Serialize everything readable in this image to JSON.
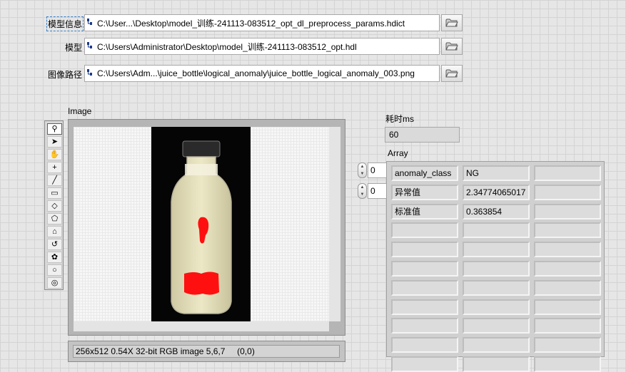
{
  "paths": [
    {
      "label": "模型信息",
      "value": "C:\\User...\\Desktop\\model_训练-241113-083512_opt_dl_preprocess_params.hdict"
    },
    {
      "label": "模型",
      "value": "C:\\Users\\Administrator\\Desktop\\model_训练-241113-083512_opt.hdl"
    },
    {
      "label": "图像路径",
      "value": "C:\\Users\\Adm...\\juice_bottle\\logical_anomaly\\juice_bottle_logical_anomaly_003.png"
    }
  ],
  "image_display": {
    "label": "Image",
    "status": "256x512 0.54X 32-bit RGB image 5,6,7     (0,0)",
    "tools": [
      "zoom-icon",
      "arrow-icon",
      "pan-icon",
      "crosshair-icon",
      "line-icon",
      "rectangle-icon",
      "rotated-rectangle-icon",
      "polygon-icon",
      "polyline-icon",
      "freehand-icon",
      "freehand-region-icon",
      "oval-icon",
      "annulus-icon"
    ]
  },
  "elapsed": {
    "label": "耗时ms",
    "value": "60"
  },
  "array": {
    "label": "Array",
    "index_row": "0",
    "index_col": "0",
    "rows": [
      [
        "anomaly_class",
        "NG",
        ""
      ],
      [
        "异常值",
        "2.34774065017",
        ""
      ],
      [
        "标准值",
        "0.363854",
        ""
      ],
      [
        "",
        "",
        ""
      ],
      [
        "",
        "",
        ""
      ],
      [
        "",
        "",
        ""
      ],
      [
        "",
        "",
        ""
      ],
      [
        "",
        "",
        ""
      ],
      [
        "",
        "",
        ""
      ],
      [
        "",
        "",
        ""
      ],
      [
        "",
        "",
        ""
      ]
    ]
  }
}
